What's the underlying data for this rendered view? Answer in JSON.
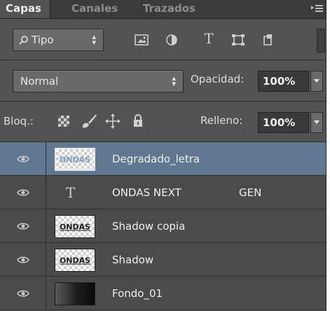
{
  "tabs": [
    {
      "label": "Capas",
      "active": true
    },
    {
      "label": "Canales",
      "active": false
    },
    {
      "label": "Trazados",
      "active": false
    }
  ],
  "filter": {
    "kind_label": "Tipo",
    "icons": [
      "image-filter-icon",
      "adjustment-filter-icon",
      "type-filter-icon",
      "shape-filter-icon",
      "smart-object-filter-icon"
    ]
  },
  "blend": {
    "mode": "Normal",
    "opacity_label": "Opacidad:",
    "opacity_value": "100%"
  },
  "lock": {
    "label": "Bloq.:",
    "fill_label": "Relleno:",
    "fill_value": "100%"
  },
  "layers": [
    {
      "name": "Degradado_letra",
      "thumb": "checker-text",
      "thumb_text": "ONDAS",
      "selected": true
    },
    {
      "name": "ONDAS NEXT",
      "extra": "GEN",
      "type": "text",
      "selected": false
    },
    {
      "name": "Shadow copia",
      "thumb": "checker-text",
      "thumb_text": "ONDAS",
      "selected": false
    },
    {
      "name": "Shadow",
      "thumb": "checker-text",
      "thumb_text": "ONDAS",
      "selected": false
    },
    {
      "name": "Fondo_01",
      "thumb": "gradient",
      "selected": false
    }
  ],
  "colors": {
    "panel": "#535353",
    "selected_row": "#5f7890",
    "field_bg": "#3a3a3a"
  }
}
